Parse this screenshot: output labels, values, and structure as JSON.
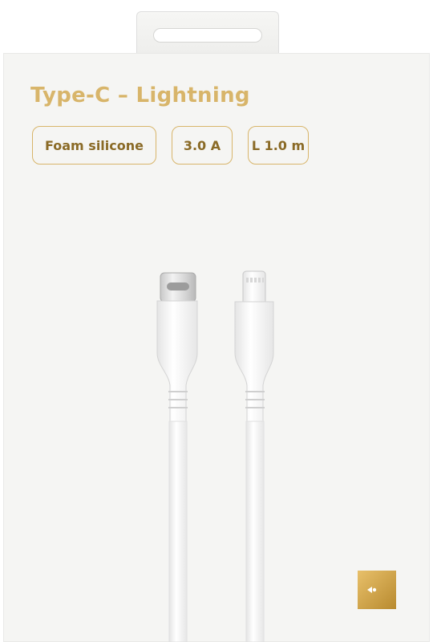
{
  "product": {
    "title": "Type-C – Lightning",
    "badges": [
      "Foam silicone",
      "3.0 A",
      "L 1.0 m"
    ]
  },
  "colors": {
    "accent_gold": "#d8b56a",
    "badge_text": "#8a6a26",
    "box_background": "#f5f5f3"
  },
  "icons": {
    "brand": "moon-fish-logo-icon",
    "left_connector": "usb-c-connector",
    "right_connector": "lightning-connector"
  }
}
